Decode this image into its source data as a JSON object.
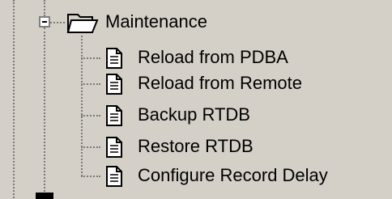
{
  "tree": {
    "folder": {
      "label": "Maintenance",
      "icon": "folder-open-icon",
      "expander": "minus"
    },
    "items": [
      {
        "label": "Reload from PDBA",
        "icon": "document-icon"
      },
      {
        "label": "Reload from Remote",
        "icon": "document-icon"
      },
      {
        "label": "Backup RTDB",
        "icon": "document-icon"
      },
      {
        "label": "Restore RTDB",
        "icon": "document-icon"
      },
      {
        "label": "Configure Record Delay",
        "icon": "document-icon"
      }
    ]
  }
}
